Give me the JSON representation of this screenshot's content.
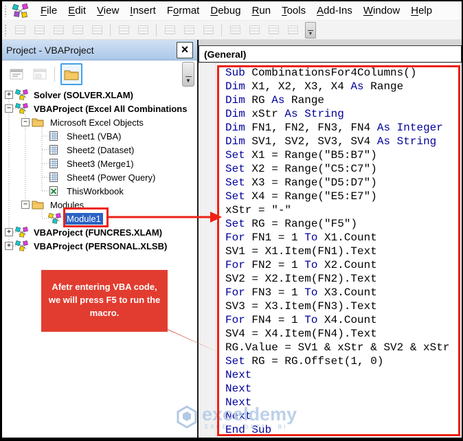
{
  "colors": {
    "annotation_red": "#ee2014",
    "callout_red": "#e23c30",
    "selection_blue": "#2a63c5",
    "keyword_blue": "#00009b"
  },
  "menu": {
    "items": [
      {
        "label": "File",
        "u": 0
      },
      {
        "label": "Edit",
        "u": 0
      },
      {
        "label": "View",
        "u": 0
      },
      {
        "label": "Insert",
        "u": 0
      },
      {
        "label": "Format",
        "u": 1
      },
      {
        "label": "Debug",
        "u": 0
      },
      {
        "label": "Run",
        "u": 0
      },
      {
        "label": "Tools",
        "u": 0
      },
      {
        "label": "Add-Ins",
        "u": 0
      },
      {
        "label": "Window",
        "u": 0
      },
      {
        "label": "Help",
        "u": 0
      }
    ]
  },
  "toolbar": {
    "icons": [
      "paste-icon",
      "copy-icon",
      "select-pointer-icon",
      "windows-icon",
      "complete-word-icon",
      "indent-icon",
      "outdent-icon",
      "breakpoint-hand-icon",
      "comment-block-icon",
      "uncomment-block-icon",
      "bookmark-icon",
      "bookmark-next-icon",
      "bookmark-prev-icon",
      "bookmark-clear-icon"
    ],
    "groups_after": [
      4,
      6,
      9
    ]
  },
  "project_panel": {
    "title": "Project - VBAProject",
    "close_label": "×",
    "toolbar_icons": [
      "view-code-icon",
      "view-object-icon",
      "toggle-folders-icon"
    ],
    "tree": [
      {
        "label": "Solver (SOLVER.XLAM)",
        "level": 0,
        "expand": "+",
        "icon": "project",
        "bold": true
      },
      {
        "label": "VBAProject (Excel All Combinations",
        "level": 0,
        "expand": "-",
        "icon": "project",
        "bold": true
      },
      {
        "label": "Microsoft Excel Objects",
        "level": 1,
        "expand": "-",
        "icon": "folder"
      },
      {
        "label": "Sheet1 (VBA)",
        "level": 2,
        "icon": "sheet"
      },
      {
        "label": "Sheet2 (Dataset)",
        "level": 2,
        "icon": "sheet"
      },
      {
        "label": "Sheet3 (Merge1)",
        "level": 2,
        "icon": "sheet"
      },
      {
        "label": "Sheet4 (Power Query)",
        "level": 2,
        "icon": "sheet"
      },
      {
        "label": "ThisWorkbook",
        "level": 2,
        "icon": "workbook"
      },
      {
        "label": "Modules",
        "level": 1,
        "expand": "-",
        "icon": "folder"
      },
      {
        "label": "Module1",
        "level": 2,
        "icon": "module",
        "selected": true
      },
      {
        "label": "VBAProject (FUNCRES.XLAM)",
        "level": 0,
        "expand": "+",
        "icon": "project",
        "bold": true
      },
      {
        "label": "VBAProject (PERSONAL.XLSB)",
        "level": 0,
        "expand": "+",
        "icon": "project",
        "bold": true
      }
    ]
  },
  "code_window": {
    "combo": "(General)",
    "keywords": [
      "Sub",
      "End",
      "Dim",
      "As",
      "Set",
      "For",
      "To",
      "Next",
      "String",
      "Integer"
    ],
    "lines": [
      "Sub CombinationsFor4Columns()",
      "Dim X1, X2, X3, X4 As Range",
      "Dim RG As Range",
      "Dim xStr As String",
      "Dim FN1, FN2, FN3, FN4 As Integer",
      "Dim SV1, SV2, SV3, SV4 As String",
      "Set X1 = Range(\"B5:B7\")",
      "Set X2 = Range(\"C5:C7\")",
      "Set X3 = Range(\"D5:D7\")",
      "Set X4 = Range(\"E5:E7\")",
      "xStr = \"-\"",
      "Set RG = Range(\"F5\")",
      "For FN1 = 1 To X1.Count",
      "SV1 = X1.Item(FN1).Text",
      "For FN2 = 1 To X2.Count",
      "SV2 = X2.Item(FN2).Text",
      "For FN3 = 1 To X3.Count",
      "SV3 = X3.Item(FN3).Text",
      "For FN4 = 1 To X4.Count",
      "SV4 = X4.Item(FN4).Text",
      "RG.Value = SV1 & xStr & SV2 & xStr",
      "Set RG = RG.Offset(1, 0)",
      "Next",
      "Next",
      "Next",
      "Next",
      "End Sub"
    ]
  },
  "annotations": {
    "callout_lines": [
      "Afetr entering VBA code,",
      "we will press F5 to run the",
      "macro."
    ]
  },
  "watermark": {
    "text": "exceldemy",
    "tagline": "EXCEL · DATA · BI"
  }
}
